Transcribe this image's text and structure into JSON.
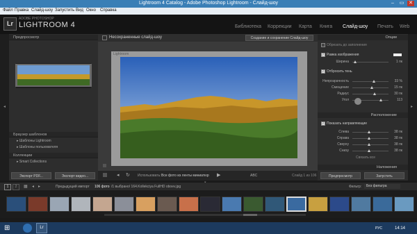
{
  "window": {
    "title": "Lightroom 4 Catalog - Adobe Photoshop Lightroom - Слайд-шоу",
    "min": "–",
    "max": "▭",
    "close": "✕"
  },
  "menu": [
    "Файл",
    "Правка",
    "Слайд-шоу",
    "Запустить",
    "Вид",
    "Окно",
    "Справка"
  ],
  "header": {
    "logo": "Lr",
    "brand_small": "ADOBE PHOTOSHOP",
    "brand": "LIGHTROOM 4"
  },
  "modules": [
    "Библиотека",
    "Коррекции",
    "Карта",
    "Книга",
    "Слайд-шоу",
    "Печать",
    "Web"
  ],
  "left": {
    "preview_header": "Предпросмотр",
    "templates_header": "Браузер шаблонов",
    "templates": [
      "Шаблоны Lightroom",
      "Шаблоны пользователя"
    ],
    "collections_header": "Коллекции",
    "collections": [
      "Smart Collections"
    ],
    "export_pdf": "Экспорт PDF...",
    "export_video": "Экспорт видео..."
  },
  "center": {
    "unsaved": "Несохраненные слайд-шоу",
    "create_btn": "Создание и сохранение Слайд-шоу",
    "slide_label": "Lightroom",
    "use_label": "Использовать:",
    "use_value": "Все фото из ленты миниатюр",
    "abc": "ABC",
    "slide_count": "Слайд 1 из 106"
  },
  "right": {
    "options_header": "Опции",
    "zoom_fill": "Обрезать до заполнения",
    "stroke": "Рамка изображения",
    "stroke_width_label": "Ширина",
    "stroke_width_value": "1 пк",
    "shadow": "Отбросить тень",
    "shadow_rows": [
      {
        "label": "Непрозрачность",
        "value": "33 %",
        "pos": 0.6
      },
      {
        "label": "Смещение",
        "value": "15 пк",
        "pos": 0.55
      },
      {
        "label": "Радиус",
        "value": "30 пк",
        "pos": 0.62
      },
      {
        "label": "Угол",
        "value": "113",
        "pos": 0.8
      }
    ],
    "layout_header": "Расположение",
    "show_guides": "Показать направляющие",
    "layout_rows": [
      {
        "label": "Слева",
        "value": "38 пк",
        "pos": 0.48
      },
      {
        "label": "Справа",
        "value": "38 пк",
        "pos": 0.48
      },
      {
        "label": "Сверху",
        "value": "38 пк",
        "pos": 0.48
      },
      {
        "label": "Снизу",
        "value": "38 пк",
        "pos": 0.48
      }
    ],
    "link_all": "Связать все",
    "overlays_header": "Наложения",
    "preview_btn": "Предпросмотр",
    "play_btn": "Запустить"
  },
  "filmstrip": {
    "page1": "1",
    "page2": "2",
    "import_info": "Предыдущий импорт",
    "photo_count": "106 фото",
    "selected": "/1 выбрано/ 164.Kollekciya FullHD oboev.jpg",
    "filter_label": "Фильтр:",
    "filter_value": "Без фильтра",
    "thumbs": [
      {
        "c": "#2a4f7a"
      },
      {
        "c": "#7a3a2a"
      },
      {
        "c": "#9aa6b4"
      },
      {
        "c": "#b0b5bb"
      },
      {
        "c": "#c4a690"
      },
      {
        "c": "#8b8f99"
      },
      {
        "c": "#d8a060"
      },
      {
        "c": "#6a5a50"
      },
      {
        "c": "#c8704a"
      },
      {
        "c": "#2a2a35"
      },
      {
        "c": "#4a7ab0"
      },
      {
        "c": "#3a5a30"
      },
      {
        "c": "#305878"
      },
      {
        "c": "#6a8050"
      },
      {
        "c": "#c8a040"
      },
      {
        "c": "#2c4a8a"
      },
      {
        "c": "#507aa0"
      },
      {
        "c": "#3a6a9a"
      },
      {
        "c": "#6a9ac0"
      }
    ]
  },
  "taskbar": {
    "lang": "РУС",
    "time": "14:14"
  }
}
